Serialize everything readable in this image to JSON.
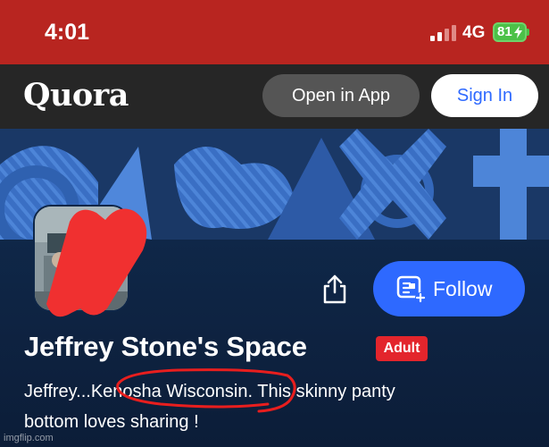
{
  "status_bar": {
    "time": "4:01",
    "network": "4G",
    "battery": "81",
    "colors": {
      "bar": "#b82520",
      "battery": "#4cc148"
    }
  },
  "header": {
    "logo": "Quora",
    "open_in_app": "Open in App",
    "sign_in": "Sign In"
  },
  "profile": {
    "title": "Jeffrey Stone's Space",
    "badge": "Adult",
    "follow_label": "Follow",
    "bio_line1": "Jeffrey...Kenosha Wisconsin. This skinny panty",
    "bio_line2": "bottom loves sharing !"
  },
  "watermark": "imgflip.com",
  "colors": {
    "accent": "#2e69ff",
    "badge": "#e3252c",
    "redaction": "#f03030",
    "background": "#0e2140"
  },
  "icons": [
    "signal-icon",
    "charging-bolt-icon",
    "share-icon",
    "follow-space-icon"
  ]
}
